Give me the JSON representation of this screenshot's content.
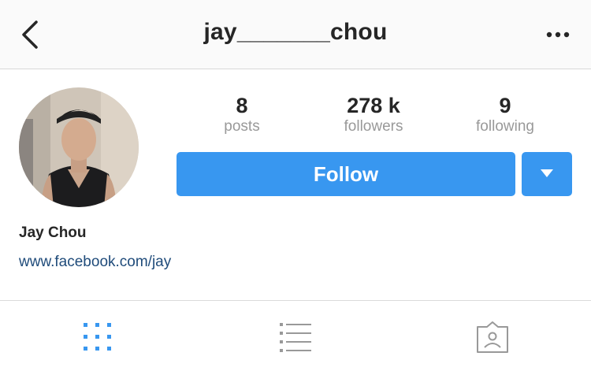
{
  "header": {
    "title": "jay_______chou",
    "back_icon": "chevron-left-icon",
    "more_icon": "more-horizontal-icon"
  },
  "profile": {
    "avatar_icon": "profile-photo-avatar",
    "display_name": "Jay Chou",
    "website": "www.facebook.com/jay"
  },
  "stats": [
    {
      "value": "8",
      "label": "posts"
    },
    {
      "value": "278 k",
      "label": "followers"
    },
    {
      "value": "9",
      "label": "following"
    }
  ],
  "actions": {
    "follow_label": "Follow",
    "dropdown_icon": "caret-down-icon"
  },
  "tabs": [
    {
      "id": "grid",
      "icon": "grid-icon",
      "active": true
    },
    {
      "id": "list",
      "icon": "list-icon",
      "active": false
    },
    {
      "id": "tagged",
      "icon": "tagged-user-icon",
      "active": false
    }
  ],
  "colors": {
    "accent": "#3897f0",
    "link": "#1f4b7a",
    "muted": "#999999",
    "text": "#262626"
  }
}
